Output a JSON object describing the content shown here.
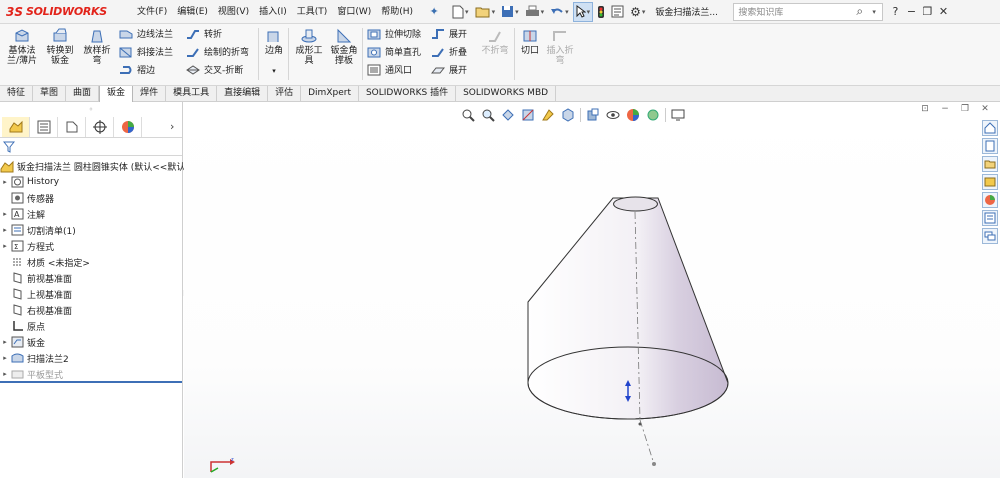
{
  "app": {
    "logo_ds": "3S",
    "logo_text": "SOLIDWORKS",
    "menus": [
      "文件(F)",
      "编辑(E)",
      "视图(V)",
      "插入(I)",
      "工具(T)",
      "窗口(W)",
      "帮助(H)"
    ],
    "doc_title": "钣金扫描法兰...",
    "search_placeholder": "搜索知识库",
    "window_controls": [
      "?",
      "−",
      "❐",
      "✕"
    ]
  },
  "commands": {
    "big": [
      {
        "label": "基体法\n兰/薄片",
        "icon": "base-flange-icon"
      },
      {
        "label": "转换到\n钣金",
        "icon": "convert-to-sheet-metal-icon"
      },
      {
        "label": "放样折\n弯",
        "icon": "lofted-bend-icon"
      }
    ],
    "col1": [
      {
        "label": "边线法兰",
        "icon": "edge-flange-icon"
      },
      {
        "label": "斜接法兰",
        "icon": "miter-flange-icon"
      },
      {
        "label": "褶边",
        "icon": "hem-icon"
      }
    ],
    "col2": [
      {
        "label": "转折",
        "icon": "jog-icon"
      },
      {
        "label": "绘制的折弯",
        "icon": "sketched-bend-icon"
      },
      {
        "label": "交叉-折断",
        "icon": "cross-break-icon"
      }
    ],
    "corner": {
      "label": "边角",
      "icon": "corners-icon"
    },
    "forming_tool": {
      "label": "成形工\n具",
      "icon": "forming-tool-icon"
    },
    "gusset": {
      "label": "钣金角\n撑板",
      "icon": "sheet-metal-gusset-icon"
    },
    "col3": [
      {
        "label": "拉伸切除",
        "icon": "extruded-cut-icon"
      },
      {
        "label": "简单直孔",
        "icon": "simple-hole-icon"
      },
      {
        "label": "通风口",
        "icon": "vent-icon"
      }
    ],
    "col4": [
      {
        "label": "展开",
        "icon": "unfold-icon"
      },
      {
        "label": "折叠",
        "icon": "fold-icon"
      },
      {
        "label": "展开",
        "icon": "flatten-icon"
      }
    ],
    "no_bends": {
      "label": "不折弯",
      "icon": "no-bends-icon"
    },
    "rip": {
      "label": "切口",
      "icon": "rip-icon"
    },
    "insert_bends": {
      "label": "插入折\n弯",
      "icon": "insert-bends-icon"
    }
  },
  "tabs": [
    "特征",
    "草图",
    "曲面",
    "钣金",
    "焊件",
    "模具工具",
    "直接编辑",
    "评估",
    "DimXpert",
    "SOLIDWORKS 插件",
    "SOLIDWORKS MBD"
  ],
  "active_tab": "钣金",
  "tree": {
    "root": "钣金扫描法兰 圆柱圆锥实体  (默认<<默认",
    "items": [
      {
        "label": "History",
        "icon": "history-icon",
        "expandable": true
      },
      {
        "label": "传感器",
        "icon": "sensor-icon",
        "expandable": false
      },
      {
        "label": "注解",
        "icon": "annotation-icon",
        "expandable": true
      },
      {
        "label": "切割清单(1)",
        "icon": "cut-list-icon",
        "expandable": true
      },
      {
        "label": "方程式",
        "icon": "equation-icon",
        "expandable": true
      },
      {
        "label": "材质 <未指定>",
        "icon": "material-icon",
        "expandable": false
      },
      {
        "label": "前视基准面",
        "icon": "plane-icon",
        "expandable": false
      },
      {
        "label": "上视基准面",
        "icon": "plane-icon",
        "expandable": false
      },
      {
        "label": "右视基准面",
        "icon": "plane-icon",
        "expandable": false
      },
      {
        "label": "原点",
        "icon": "origin-icon",
        "expandable": false
      },
      {
        "label": "钣金",
        "icon": "sheet-metal-icon",
        "expandable": true
      },
      {
        "label": "扫描法兰2",
        "icon": "swept-flange-icon",
        "expandable": true
      },
      {
        "label": "平板型式",
        "icon": "flat-pattern-icon",
        "expandable": true,
        "dim": true
      }
    ]
  },
  "colors": {
    "brand": "#e2231a",
    "accent": "#3d6fb6",
    "cone_body": "#f2eef5",
    "cone_shade": "#c9bfd2"
  }
}
